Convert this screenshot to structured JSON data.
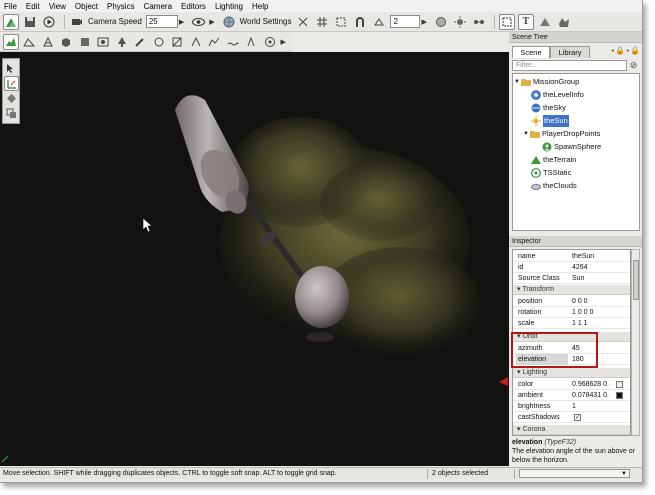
{
  "menu": [
    "File",
    "Edit",
    "View",
    "Object",
    "Physics",
    "Camera",
    "Editors",
    "Lighting",
    "Help"
  ],
  "toolbar": {
    "camera_speed_label": "Camera Speed",
    "camera_speed_value": "25",
    "world_settings_label": "World Settings",
    "snap_value": "2"
  },
  "scene_tree": {
    "title": "Scene Tree",
    "tabs": [
      "Scene",
      "Library"
    ],
    "filter_placeholder": "Filter...",
    "items": [
      {
        "label": "MissionGroup",
        "icon": "folder-icon"
      },
      {
        "label": "theLevelInfo",
        "icon": "level-info-icon"
      },
      {
        "label": "theSky",
        "icon": "sky-icon"
      },
      {
        "label": "theSun",
        "icon": "sun-icon",
        "selected": true
      },
      {
        "label": "PlayerDropPoints",
        "icon": "folder-icon"
      },
      {
        "label": "SpawnSphere",
        "icon": "spawn-sphere-icon"
      },
      {
        "label": "theTerrain",
        "icon": "terrain-icon"
      },
      {
        "label": "TSStatic",
        "icon": "tsstatic-icon"
      },
      {
        "label": "theClouds",
        "icon": "clouds-icon"
      }
    ]
  },
  "inspector": {
    "title": "Inspector",
    "rows_top": [
      {
        "k": "name",
        "v": "theSun"
      },
      {
        "k": "id",
        "v": "4264"
      },
      {
        "k": "Source Class",
        "v": "Sun"
      }
    ],
    "transform_label": "Transform",
    "transform_rows": [
      {
        "k": "position",
        "v": "0 0 0"
      },
      {
        "k": "rotation",
        "v": "1 0 0 0"
      },
      {
        "k": "scale",
        "v": "1 1 1"
      }
    ],
    "orbit_label": "Orbit",
    "orbit_rows": [
      {
        "k": "azimuth",
        "v": "45"
      },
      {
        "k": "elevation",
        "v": "180"
      }
    ],
    "lighting_label": "Lighting",
    "lighting_rows": [
      {
        "k": "color",
        "v": "0.968628 0."
      },
      {
        "k": "ambient",
        "v": "0.078431 0."
      },
      {
        "k": "brightness",
        "v": "1"
      },
      {
        "k": "castShadows",
        "v": ""
      }
    ],
    "corona_label": "Corona",
    "colors": {
      "color_swatch": "#f6efe6",
      "ambient_swatch": "#141414",
      "highlight": "#b01818",
      "selection": "#3f71c9"
    }
  },
  "description": {
    "field": "elevation",
    "type": "(TypeF32)",
    "text": "The elevation angle of the sun above or below the horizon."
  },
  "status": {
    "message": "Move selection.  SHIFT while dragging duplicates objects.  CTRL to toggle soft snap.  ALT to toggle grid snap.",
    "selection": "2 objects selected"
  }
}
